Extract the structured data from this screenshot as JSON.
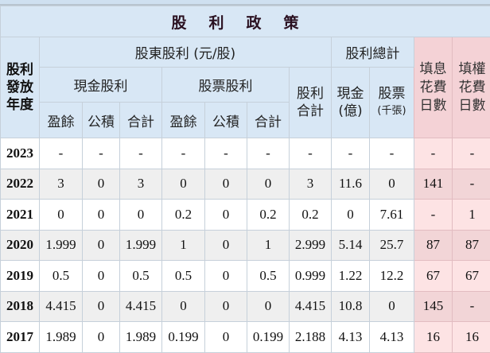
{
  "title": "股利政策",
  "headers": {
    "year": "股利發放年度",
    "shareholder_dividend": "股東股利 (元/股)",
    "dividend_total": "股利總計",
    "fill_interest": "填息花費日數",
    "fill_rights": "填權花費日數",
    "cash_dividend": "現金股利",
    "stock_dividend": "股票股利",
    "dividend_sum": "股利合計",
    "cash_total_a": "現金",
    "cash_total_b": "(億)",
    "stock_total_a": "股票",
    "stock_total_b": "(千張)",
    "earnings": "盈餘",
    "reserve": "公積",
    "subtotal": "合計"
  },
  "rows": [
    [
      "2023",
      "-",
      "-",
      "-",
      "-",
      "-",
      "-",
      "-",
      "-",
      "-",
      "-",
      "-"
    ],
    [
      "2022",
      "3",
      "0",
      "3",
      "0",
      "0",
      "0",
      "3",
      "11.6",
      "0",
      "141",
      "-"
    ],
    [
      "2021",
      "0",
      "0",
      "0",
      "0.2",
      "0",
      "0.2",
      "0.2",
      "0",
      "7.61",
      "-",
      "1"
    ],
    [
      "2020",
      "1.999",
      "0",
      "1.999",
      "1",
      "0",
      "1",
      "2.999",
      "5.14",
      "25.7",
      "87",
      "87"
    ],
    [
      "2019",
      "0.5",
      "0",
      "0.5",
      "0.5",
      "0",
      "0.5",
      "0.999",
      "1.22",
      "12.2",
      "67",
      "67"
    ],
    [
      "2018",
      "4.415",
      "0",
      "4.415",
      "0",
      "0",
      "0",
      "4.415",
      "10.8",
      "0",
      "145",
      "-"
    ],
    [
      "2017",
      "1.989",
      "0",
      "1.989",
      "0.199",
      "0",
      "0.199",
      "2.188",
      "4.13",
      "4.13",
      "16",
      "16"
    ]
  ]
}
